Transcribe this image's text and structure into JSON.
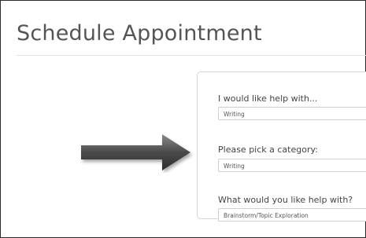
{
  "page": {
    "title": "Schedule Appointment"
  },
  "form": {
    "fields": [
      {
        "label": "I would like help with...",
        "value": "Writing"
      },
      {
        "label": "Please pick a category:",
        "value": "Writing"
      },
      {
        "label": "What would you like help with?",
        "value": "Brainstorm/Topic Exploration"
      }
    ]
  },
  "annotation": {
    "icon": "arrow-right-icon",
    "color": "#555555"
  }
}
